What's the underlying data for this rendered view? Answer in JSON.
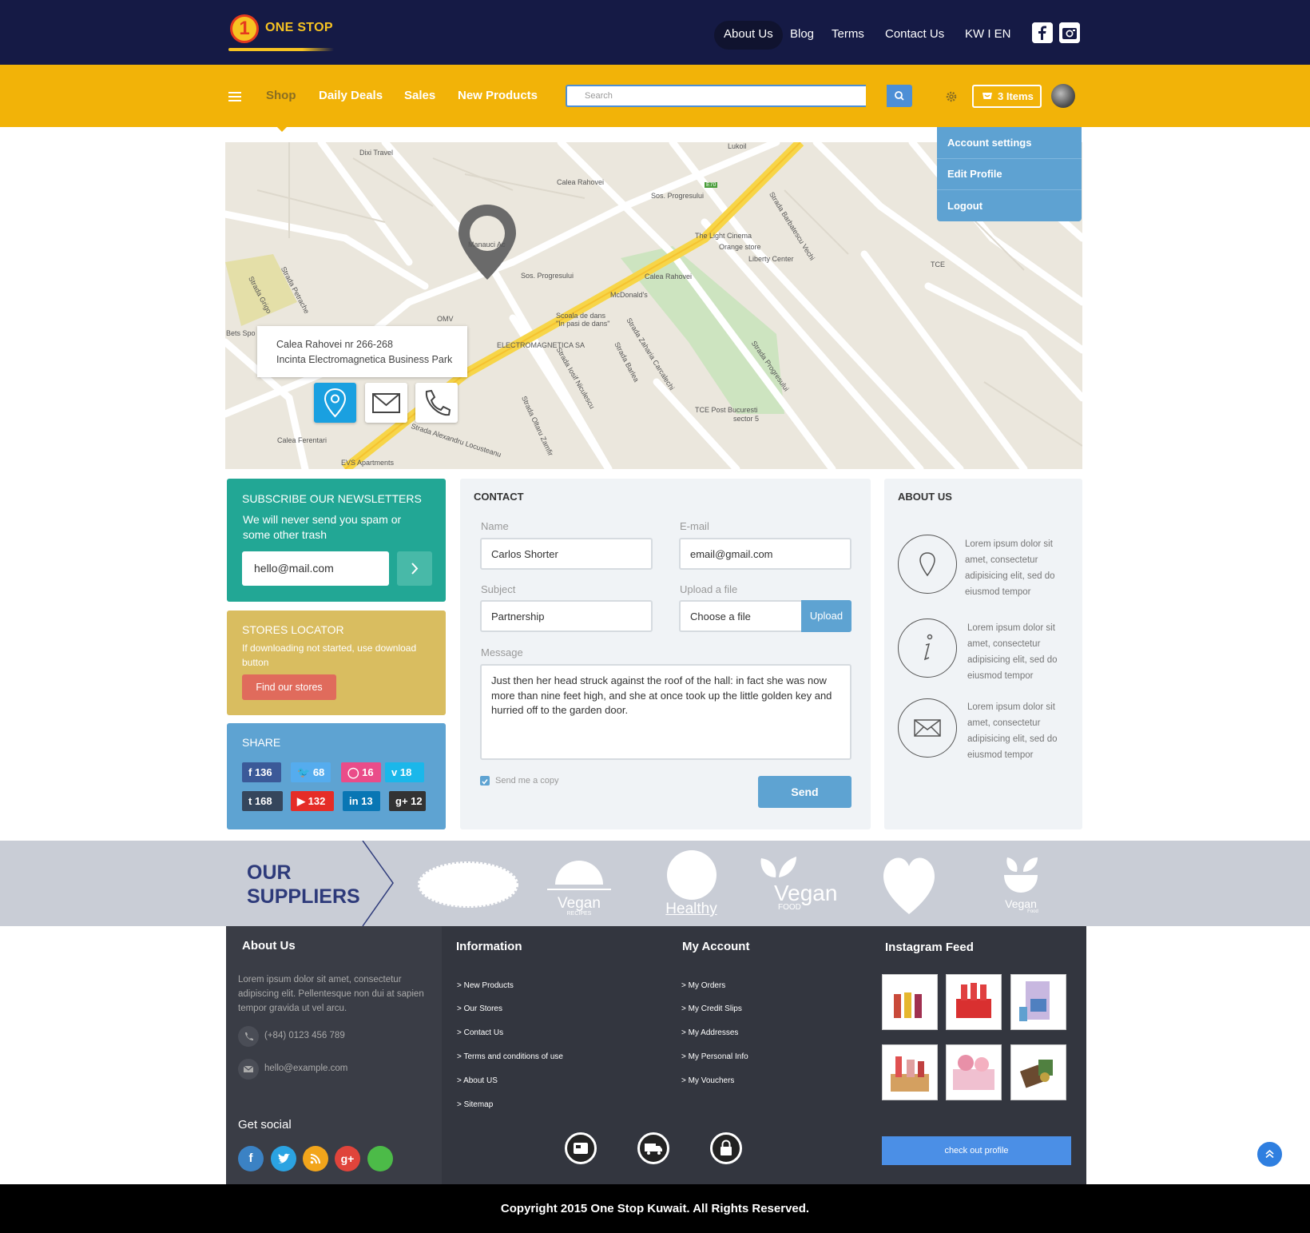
{
  "brand": {
    "logo_number": "1",
    "logo_text": "ONE STOP"
  },
  "top_nav": {
    "items": [
      "About Us",
      "Blog",
      "Terms",
      "Contact Us",
      "KW I EN"
    ]
  },
  "main_nav": {
    "items": [
      "Shop",
      "Daily Deals",
      "Sales",
      "New Products"
    ]
  },
  "search": {
    "placeholder": "Search"
  },
  "cart": {
    "label": "3 Items"
  },
  "account_menu": {
    "items": [
      "Account settings",
      "Edit Profile",
      "Logout"
    ]
  },
  "map": {
    "address_line1": "Calea Rahovei nr 266-268",
    "address_line2": "Incinta Electromagnetica Business Park",
    "labels": [
      "Dixi Travel",
      "Lukoil",
      "Calea Rahovei",
      "Sos. Progresului",
      "E70",
      "The Light Cinema",
      "Orange store",
      "Liberty Center",
      "Sos. Progresului",
      "Calea Rahovei",
      "McDonald's",
      "Scoala de dans",
      "\"In pasi de dans\"",
      "ELECTROMAGNETICA SA",
      "OMV",
      "Strada Barlea",
      "Strada Progresului",
      "TCE Post Bucuresti",
      "sector 5",
      "Calea Ferentari",
      "EVS Apartments",
      "Strada Alexandru Locusteanu",
      "Strada Oltaru Zamfir",
      "Strada Iosif Niculescu",
      "Strada Zaharia Carcalechi",
      "Bets Spo",
      "TCE",
      "Strada Petrache",
      "Strada Grigo",
      "Strada Barbatescu Vechi",
      "Manauci Ac"
    ]
  },
  "newsletter": {
    "title": "SUBSCRIBE OUR NEWSLETTERS",
    "subtitle": "We will never send you spam or some other trash",
    "email_value": "hello@mail.com"
  },
  "stores": {
    "title": "STORES LOCATOR",
    "subtitle": "If downloading not started, use download button",
    "button": "Find our stores"
  },
  "share": {
    "title": "SHARE",
    "items": [
      {
        "icon": "f",
        "count": "136",
        "color": "#3b5998"
      },
      {
        "icon": "twitter-icon",
        "count": "68",
        "color": "#55acee"
      },
      {
        "icon": "dribbble-icon",
        "count": "16",
        "color": "#ea4c89"
      },
      {
        "icon": "v",
        "count": "18",
        "color": "#1ab7ea"
      },
      {
        "icon": "t",
        "count": "168",
        "color": "#35465c"
      },
      {
        "icon": "youtube-icon",
        "count": "132",
        "color": "#e52d27"
      },
      {
        "icon": "in",
        "count": "13",
        "color": "#0976b4"
      },
      {
        "icon": "g+",
        "count": "12",
        "color": "#333333"
      }
    ]
  },
  "contact": {
    "title": "CONTACT",
    "name_label": "Name",
    "name_value": "Carlos Shorter",
    "email_label": "E-mail",
    "email_value": "email@gmail.com",
    "subject_label": "Subject",
    "subject_value": "Partnership",
    "upload_label": "Upload a file",
    "upload_value": "Choose a file",
    "upload_button": "Upload",
    "message_label": "Message",
    "message_value": "Just then her head struck against the roof of the hall: in fact she was now more than nine feet high, and she at once took up the little golden key and hurried off to the garden door.",
    "copy_label": "Send me a copy",
    "send_button": "Send"
  },
  "about": {
    "title": "ABOUT US",
    "items": [
      {
        "icon": "pin-icon",
        "text": "Lorem ipsum dolor sit amet, consectetur adipisicing elit, sed do eiusmod tempor"
      },
      {
        "icon": "info-icon",
        "text": "Lorem ipsum dolor sit amet, consectetur adipisicing elit, sed do eiusmod tempor"
      },
      {
        "icon": "mail-icon",
        "text": "Lorem ipsum dolor sit amet, consectetur adipisicing elit, sed do eiusmod tempor"
      }
    ]
  },
  "suppliers": {
    "title_line1": "OUR",
    "title_line2": "SUPPLIERS",
    "logos": [
      {
        "main": "",
        "sub": ""
      },
      {
        "main": "Vegan",
        "sub": "RECIPES"
      },
      {
        "main": "Healthy",
        "sub": ""
      },
      {
        "main": "Vegan",
        "sub": "FOOD"
      },
      {
        "main": "",
        "sub": ""
      },
      {
        "main": "Vegan",
        "sub": "Food"
      }
    ]
  },
  "footer": {
    "about_title": "About Us",
    "about_text": "Lorem ipsum dolor sit amet, consectetur adipiscing elit. Pellentesque non dui at sapien tempor gravida ut vel arcu.",
    "phone": "(+84) 0123 456 789",
    "email": "hello@example.com",
    "social_title": "Get social",
    "social_colors": [
      "#3b82c4",
      "#2ba3e2",
      "#f2a51b",
      "#e0443b",
      "#4cbb48"
    ],
    "info_title": "Information",
    "info_links": [
      "> New Products",
      "> Our Stores",
      "> Contact Us",
      "> Terms and conditions of use",
      "> About US",
      "> Sitemap"
    ],
    "account_title": "My Account",
    "account_links": [
      "> My Orders",
      "> My Credit Slips",
      "> My Addresses",
      "> My Personal Info",
      "> My Vouchers"
    ],
    "instagram_title": "Instagram Feed",
    "instagram_button": "check out profile",
    "copyright": "Copyright 2015 One Stop Kuwait. All Rights Reserved."
  },
  "colors": {
    "navy": "#151a45",
    "yellow": "#f2b308",
    "teal": "#22a795",
    "mustard": "#d9bd60",
    "blue": "#5ea3d2",
    "coral": "#e06b5c",
    "footer": "#33363f"
  }
}
